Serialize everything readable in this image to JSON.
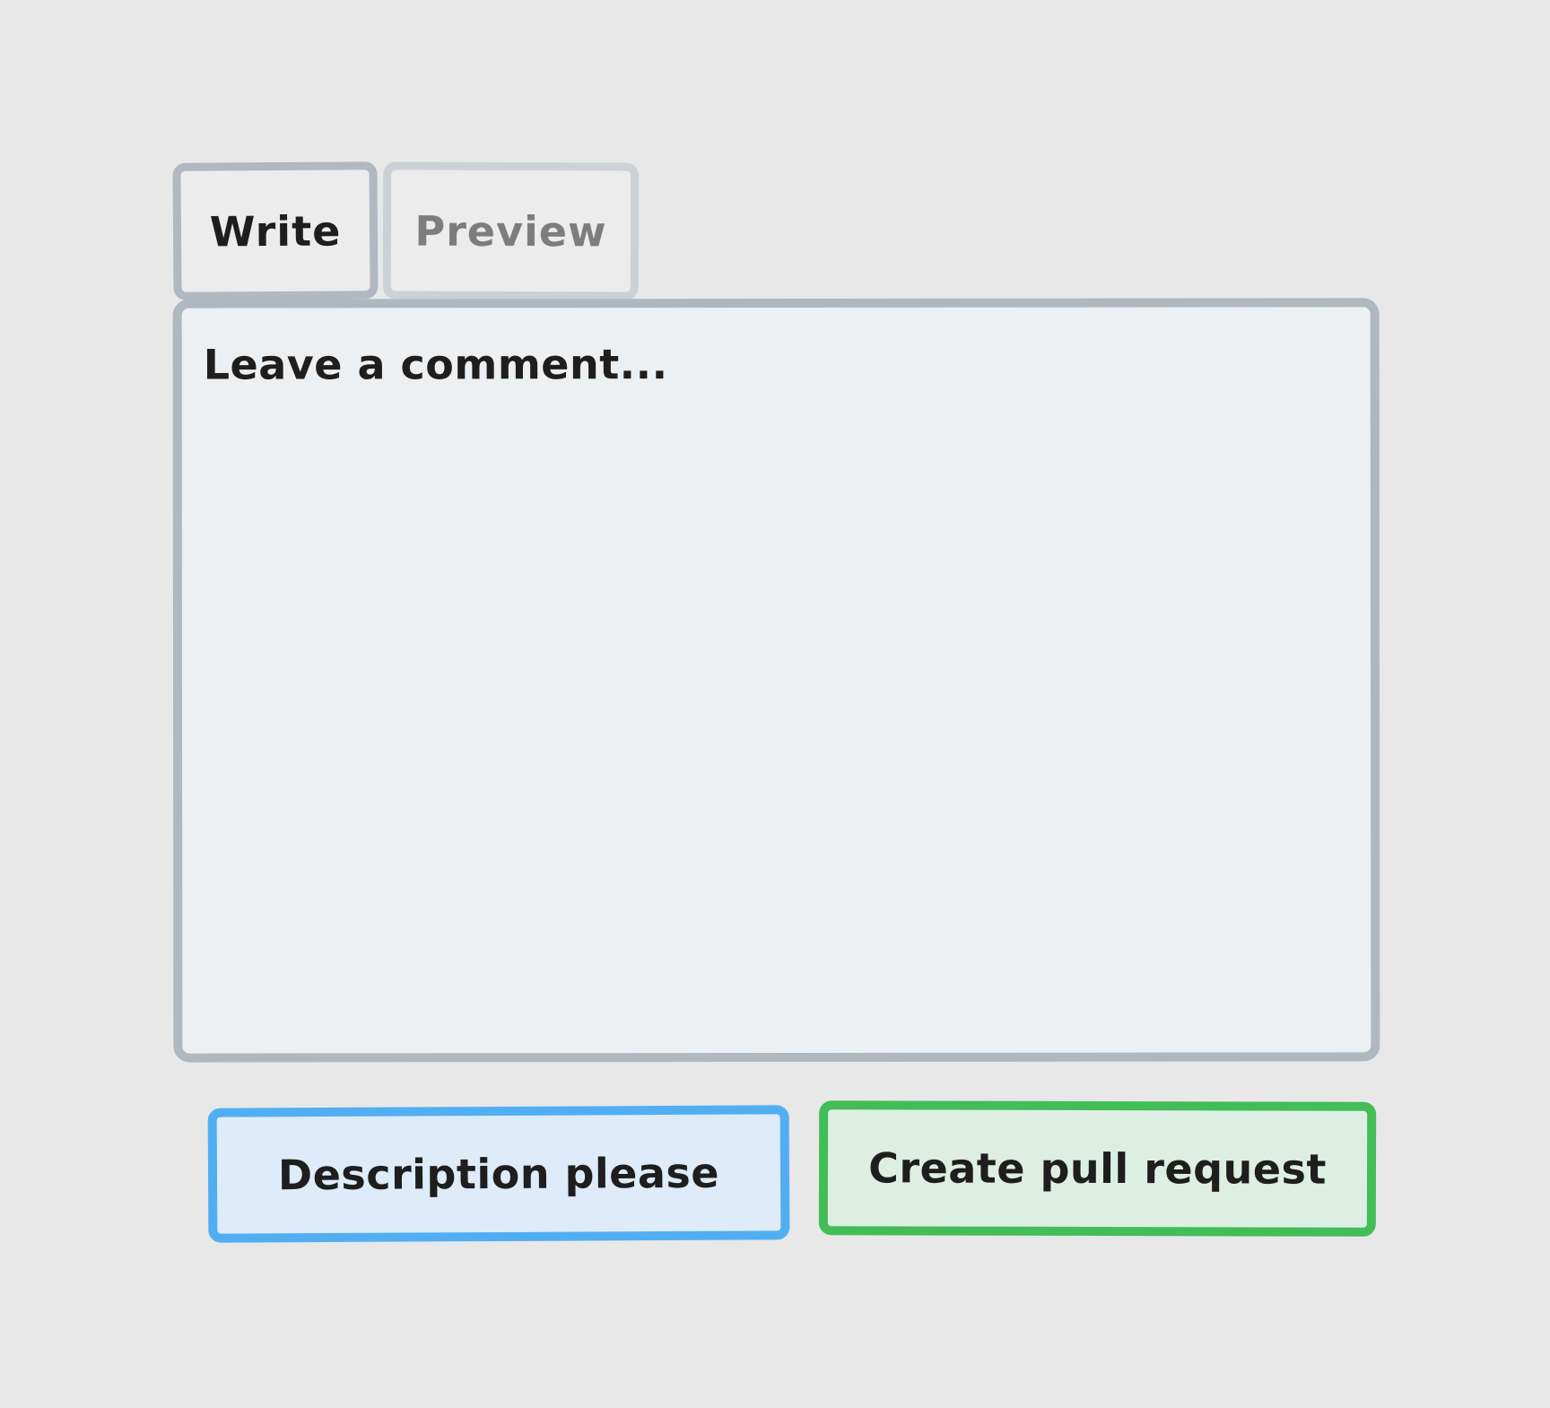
{
  "tabs": {
    "write_label": "Write",
    "preview_label": "Preview",
    "active": "Write"
  },
  "comment": {
    "placeholder": "Leave a comment..."
  },
  "actions": {
    "description_label": "Description please",
    "create_label": "Create pull request"
  },
  "colors": {
    "background": "#e8e8e8",
    "border_gray": "#b0b8bf",
    "description_border": "#52aef3",
    "description_fill": "#ddecf8",
    "create_border": "#43bd57",
    "create_fill": "#ddefe2"
  }
}
